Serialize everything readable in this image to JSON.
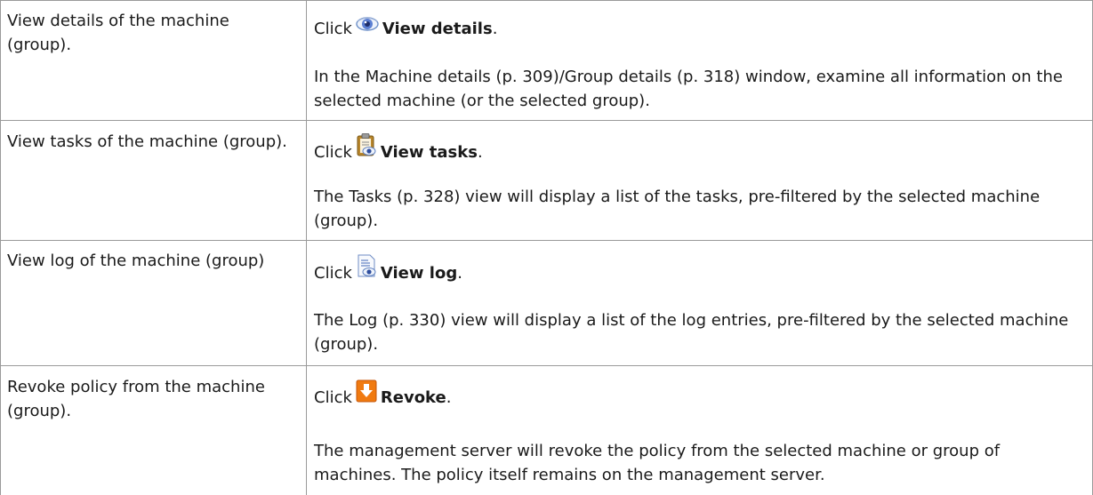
{
  "rows": [
    {
      "task": "View details of the machine (group).",
      "click": "Click",
      "action_label": "View details",
      "period": ".",
      "description": "In the Machine details (p. 309)/Group details (p. 318) window, examine all information on the selected machine (or the selected group).",
      "icon": "view-details-eye-icon"
    },
    {
      "task": "View tasks of the machine (group).",
      "click": "Click",
      "action_label": "View tasks",
      "period": ".",
      "description": "The Tasks (p. 328) view will display a list of the tasks, pre-filtered by the selected machine (group).",
      "icon": "view-tasks-clipboard-icon"
    },
    {
      "task": "View log of the machine (group)",
      "click": "Click",
      "action_label": "View log",
      "period": ".",
      "description": "The Log (p. 330) view will display a list of the log entries, pre-filtered by the selected machine (group).",
      "icon": "view-log-document-icon"
    },
    {
      "task": "Revoke policy from the machine (group).",
      "click": "Click",
      "action_label": "Revoke",
      "period": ".",
      "description": "The management server will revoke the policy from the selected machine or group of machines. The policy itself remains on the management server.",
      "icon": "revoke-arrow-icon"
    }
  ],
  "colors": {
    "border": "#9a9a9a",
    "revoke_icon": "#f07a10"
  }
}
